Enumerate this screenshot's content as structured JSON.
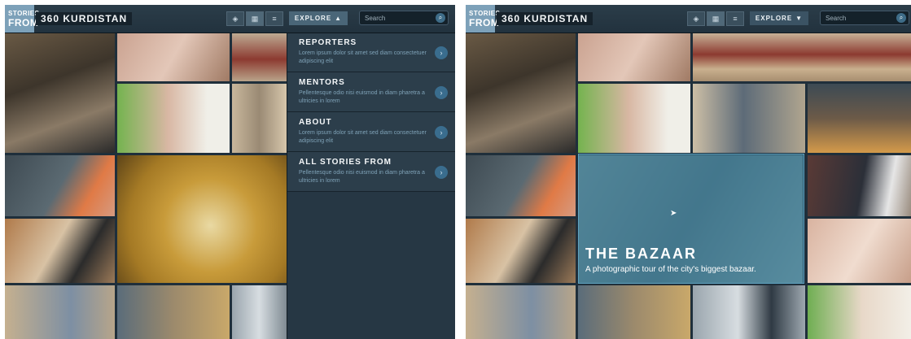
{
  "header": {
    "logo_line1": "STORIES",
    "logo_line2": "FROM",
    "site_title": "360 KURDISTAN",
    "view_icons": [
      "map-view-icon",
      "grid-view-icon",
      "list-view-icon"
    ],
    "explore_label": "EXPLORE",
    "search_placeholder": "Search"
  },
  "menu": {
    "items": [
      {
        "title": "REPORTERS",
        "desc": "Lorem ipsum dolor sit amet sed diam consectetuer adipiscing elit"
      },
      {
        "title": "MENTORS",
        "desc": "Pellentesque odio nisi euismod in diam pharetra a ultricies in lorem"
      },
      {
        "title": "ABOUT",
        "desc": "Lorem ipsum dolor sit amet sed diam consectetuer adipiscing elit"
      },
      {
        "title": "ALL STORIES FROM",
        "desc": "Pellentesque odio nisi euismod in diam pharetra a ultricies in lorem"
      }
    ]
  },
  "feature": {
    "title": "THE BAZAAR",
    "subtitle": "A photographic tour of the city's biggest bazaar."
  },
  "colors": {
    "brand": "#7da1b9",
    "panel_bg": "#1f2f3b",
    "menu_bg": "#2c3e4b",
    "accent": "#3a6d8e"
  }
}
